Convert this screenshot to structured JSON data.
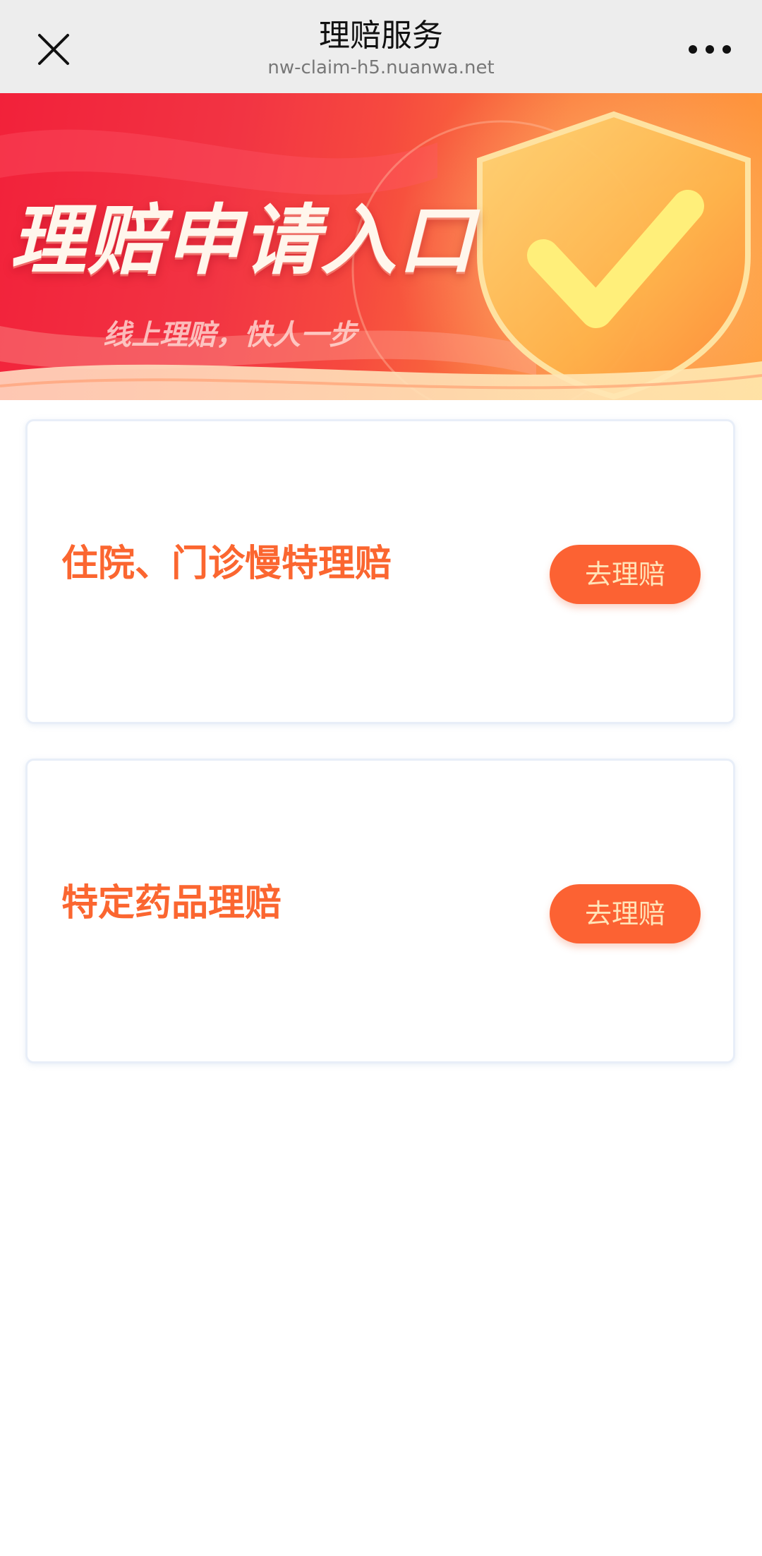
{
  "header": {
    "title": "理赔服务",
    "url": "nw-claim-h5.nuanwa.net",
    "close_icon": "close-icon",
    "more_icon": "more-dots-icon"
  },
  "banner": {
    "title": "理赔申请入口",
    "subtitle": "线上理赔，快人一步",
    "icon": "shield-check-icon"
  },
  "cards": [
    {
      "title": "住院、门诊慢特理赔",
      "button_label": "去理赔"
    },
    {
      "title": "特定药品理赔",
      "button_label": "去理赔"
    }
  ],
  "colors": {
    "accent": "#fb6630",
    "button_bg": "#fc6233",
    "button_text": "#ffe3b8",
    "topbar_bg": "#ededed"
  }
}
